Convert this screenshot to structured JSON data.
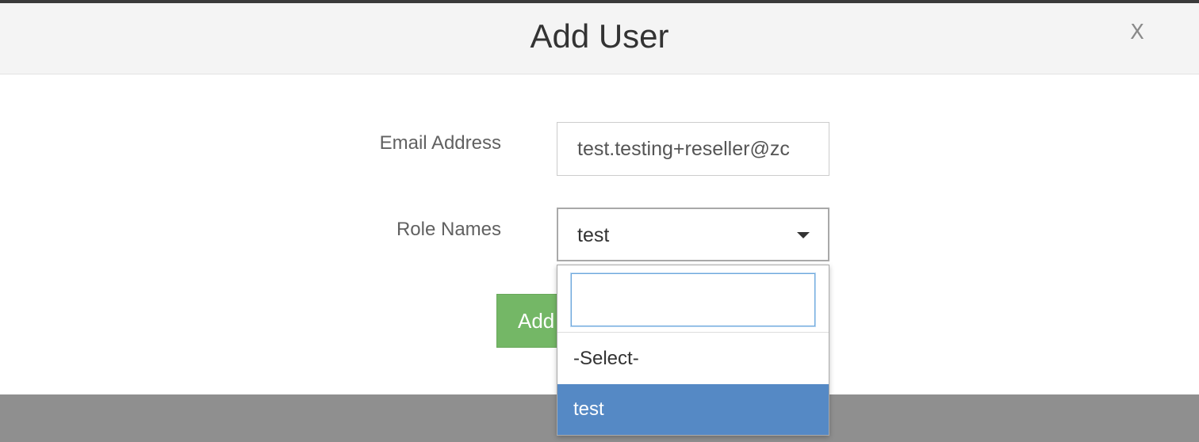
{
  "modal": {
    "title": "Add User",
    "close_label": "X"
  },
  "form": {
    "email": {
      "label": "Email Address",
      "value": "test.testing+reseller@zc"
    },
    "role": {
      "label": "Role Names",
      "selected": "test"
    },
    "submit_label": "Add"
  },
  "dropdown": {
    "search_value": "",
    "options": [
      {
        "label": "-Select-",
        "highlighted": false
      },
      {
        "label": "test",
        "highlighted": true
      }
    ]
  },
  "icons": {
    "caret": "chevron-down-icon",
    "close": "close-icon"
  },
  "colors": {
    "header_bg": "#f4f4f4",
    "add_button": "#74b766",
    "highlight": "#5589c5",
    "search_border": "#6ea8dc",
    "footer_band": "#8f8f8f"
  }
}
